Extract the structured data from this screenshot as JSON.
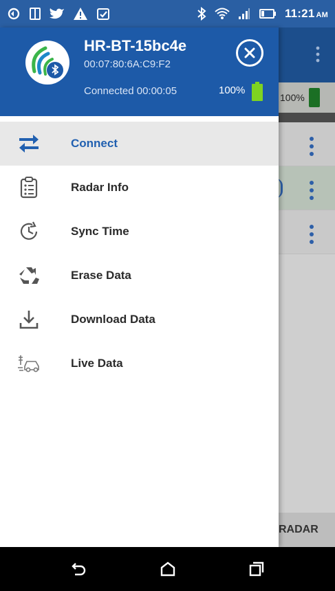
{
  "status_bar": {
    "time": "11:21",
    "ampm": "AM",
    "icons": [
      "sync-icon",
      "tablet-icon",
      "twitter-icon",
      "warning-icon",
      "clipboard-check-icon",
      "bluetooth-icon",
      "wifi-icon",
      "signal-icon",
      "battery-icon"
    ]
  },
  "background_app": {
    "battery_text": "100%",
    "footer_label": "RADAR"
  },
  "drawer": {
    "device_name": "HR-BT-15bc4e",
    "device_mac": "00:07:80:6A:C9:F2",
    "connection_status": "Connected 00:00:05",
    "battery_percent": "100%",
    "colors": {
      "header": "#1d5aa8",
      "accent": "#2160b0",
      "battery": "#7ed321"
    },
    "menu": [
      {
        "label": "Connect",
        "icon": "swap-arrows-icon",
        "selected": true
      },
      {
        "label": "Radar Info",
        "icon": "clipboard-list-icon",
        "selected": false
      },
      {
        "label": "Sync Time",
        "icon": "clock-sync-icon",
        "selected": false
      },
      {
        "label": "Erase Data",
        "icon": "recycle-icon",
        "selected": false
      },
      {
        "label": "Download Data",
        "icon": "download-icon",
        "selected": false
      },
      {
        "label": "Live Data",
        "icon": "car-radar-icon",
        "selected": false
      }
    ]
  },
  "nav_bar": {
    "buttons": [
      "back-icon",
      "home-icon",
      "recents-icon"
    ]
  }
}
